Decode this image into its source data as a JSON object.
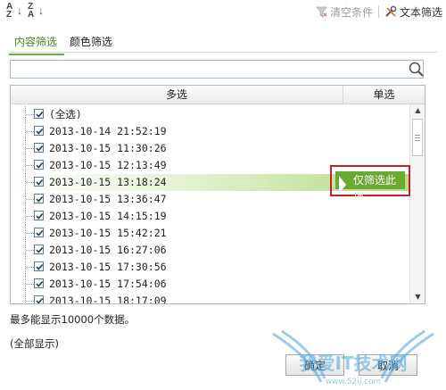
{
  "toolbar": {
    "sort_asc_label": "A Z",
    "sort_desc_label": "Z A",
    "clear_label": "清空条件",
    "text_filter_label": "文本筛选"
  },
  "tabs": [
    {
      "label": "内容筛选",
      "active": true
    },
    {
      "label": "颜色筛选",
      "active": false
    }
  ],
  "search": {
    "value": "",
    "placeholder": ""
  },
  "columns": {
    "multi": "多选",
    "single": "单选"
  },
  "items": [
    {
      "label": "(全选)",
      "checked": true
    },
    {
      "label": "2013-10-14 21:52:19",
      "checked": true
    },
    {
      "label": "2013-10-15 11:30:26",
      "checked": true
    },
    {
      "label": "2013-10-15 12:13:49",
      "checked": true
    },
    {
      "label": "2013-10-15 13:18:24",
      "checked": true,
      "highlighted": true
    },
    {
      "label": "2013-10-15 13:36:47",
      "checked": true
    },
    {
      "label": "2013-10-15 14:15:19",
      "checked": true
    },
    {
      "label": "2013-10-15 15:42:21",
      "checked": true
    },
    {
      "label": "2013-10-15 16:27:06",
      "checked": true
    },
    {
      "label": "2013-10-15 17:30:56",
      "checked": true
    },
    {
      "label": "2013-10-15 17:54:06",
      "checked": true
    },
    {
      "label": "2013-10-15 18:17:09",
      "checked": true
    }
  ],
  "only_filter_label": "仅筛选此项",
  "footer": {
    "info": "最多能显示10000个数据。",
    "show_all": "(全部显示)",
    "ok_label": "确定",
    "cancel_label": "取消"
  },
  "watermark": {
    "text": "我爱IT技术网",
    "url": "www.52ij.com"
  },
  "colors": {
    "accent_green": "#6aaa31",
    "highlight_border": "#c71f26",
    "checkbox_border": "#5b7a9a"
  }
}
